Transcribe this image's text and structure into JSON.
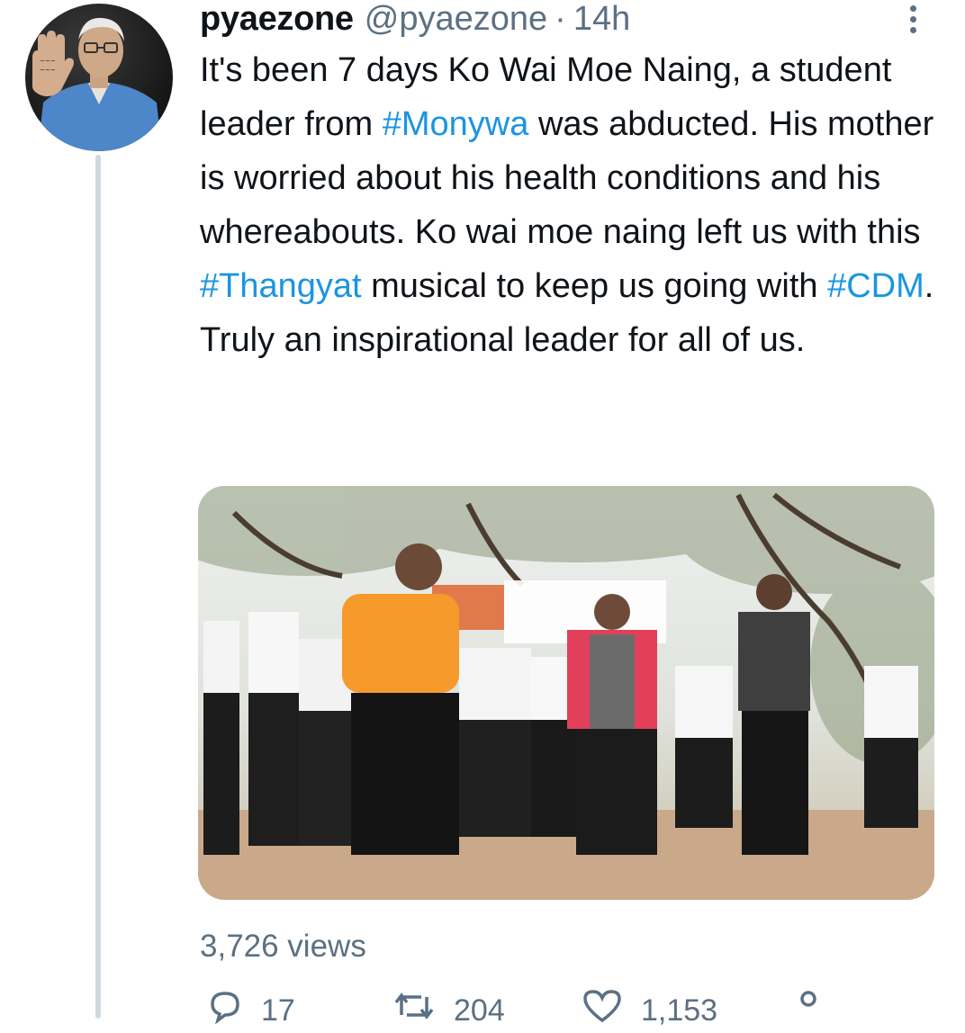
{
  "tweet": {
    "display_name": "pyaezone",
    "handle": "@pyaezone",
    "separator": "·",
    "time": "14h",
    "text_segments": [
      {
        "text": "It's been 7 days Ko Wai Moe Naing, a student leader from ",
        "type": "text"
      },
      {
        "text": "#Monywa",
        "type": "hashtag"
      },
      {
        "text": " was abducted. His mother is worried about his health conditions and his whereabouts. Ko wai moe naing left us with this ",
        "type": "text"
      },
      {
        "text": "#Thangyat",
        "type": "hashtag"
      },
      {
        "text": " musical to keep us going with ",
        "type": "text"
      },
      {
        "text": "#CDM",
        "type": "hashtag"
      },
      {
        "text": ". Truly an inspirational leader for all of us.",
        "type": "text"
      }
    ],
    "views": "3,726 views"
  },
  "media": {
    "icon": "video-thumbnail"
  },
  "actions": [
    {
      "icon": "reply-icon",
      "count": "17"
    },
    {
      "icon": "retweet-icon",
      "count": "204"
    },
    {
      "icon": "like-icon",
      "count": "1,153"
    },
    {
      "icon": "share-icon",
      "count": ""
    }
  ],
  "colors": {
    "hashtag": "#1b95e0",
    "secondary_text": "#5b7083",
    "primary_text": "#0f1419",
    "thread_line": "#cfd9de"
  }
}
